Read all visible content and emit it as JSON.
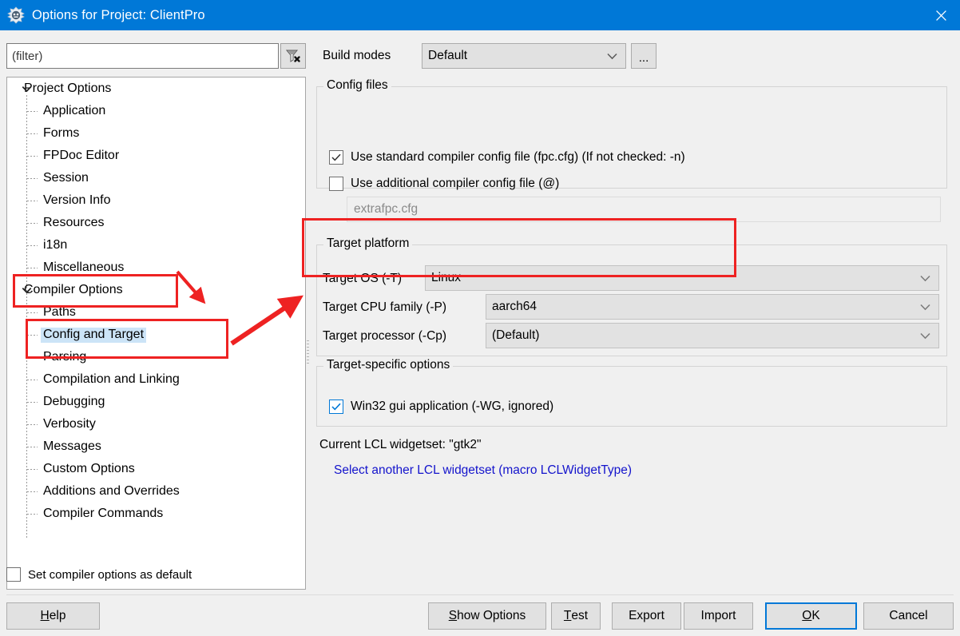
{
  "window": {
    "title": "Options for Project: ClientPro",
    "icon": "lazarus-logo-icon",
    "close_label": "✕"
  },
  "filter": {
    "placeholder": "(filter)",
    "value": "",
    "clear_icon": "filter-clear-icon"
  },
  "build_modes": {
    "label": "Build modes",
    "value": "Default",
    "ellipsis_label": "...",
    "dropdown_icon": "chevron-down-icon"
  },
  "tree": {
    "items": [
      {
        "label": "Project Options",
        "level": 0,
        "expander": "chevron-down",
        "selected": false
      },
      {
        "label": "Application",
        "level": 1,
        "expander": "",
        "selected": false
      },
      {
        "label": "Forms",
        "level": 1,
        "expander": "",
        "selected": false
      },
      {
        "label": "FPDoc Editor",
        "level": 1,
        "expander": "",
        "selected": false
      },
      {
        "label": "Session",
        "level": 1,
        "expander": "",
        "selected": false
      },
      {
        "label": "Version Info",
        "level": 1,
        "expander": "",
        "selected": false
      },
      {
        "label": "Resources",
        "level": 1,
        "expander": "",
        "selected": false
      },
      {
        "label": "i18n",
        "level": 1,
        "expander": "",
        "selected": false
      },
      {
        "label": "Miscellaneous",
        "level": 1,
        "expander": "",
        "selected": false
      },
      {
        "label": "Compiler Options",
        "level": 0,
        "expander": "chevron-down",
        "selected": false
      },
      {
        "label": "Paths",
        "level": 1,
        "expander": "",
        "selected": false
      },
      {
        "label": "Config and Target",
        "level": 1,
        "expander": "",
        "selected": true
      },
      {
        "label": "Parsing",
        "level": 1,
        "expander": "",
        "selected": false
      },
      {
        "label": "Compilation and Linking",
        "level": 1,
        "expander": "",
        "selected": false
      },
      {
        "label": "Debugging",
        "level": 1,
        "expander": "",
        "selected": false
      },
      {
        "label": "Verbosity",
        "level": 1,
        "expander": "",
        "selected": false
      },
      {
        "label": "Messages",
        "level": 1,
        "expander": "",
        "selected": false
      },
      {
        "label": "Custom Options",
        "level": 1,
        "expander": "",
        "selected": false
      },
      {
        "label": "Additions and Overrides",
        "level": 1,
        "expander": "",
        "selected": false
      },
      {
        "label": "Compiler Commands",
        "level": 1,
        "expander": "",
        "selected": false
      }
    ]
  },
  "config_files": {
    "caption": "Config files",
    "standard_cfg_label": "Use standard compiler config file (fpc.cfg) (If not checked: -n)",
    "standard_cfg_checked": true,
    "additional_cfg_label": "Use additional compiler config file (@)",
    "additional_cfg_checked": false,
    "additional_cfg_value": "extrafpc.cfg"
  },
  "target_platform": {
    "caption": "Target platform",
    "rows": [
      {
        "label": "Target OS (-T)",
        "value": "Linux"
      },
      {
        "label": "Target CPU family (-P)",
        "value": "aarch64"
      },
      {
        "label": "Target processor (-Cp)",
        "value": "(Default)"
      }
    ]
  },
  "target_specific": {
    "caption": "Target-specific options",
    "win32_gui_label": "Win32 gui application (-WG, ignored)",
    "win32_gui_checked": true
  },
  "widgetset": {
    "current_line": "Current LCL widgetset: \"gtk2\"",
    "link_label": "Select another LCL widgetset (macro LCLWidgetType)"
  },
  "footer": {
    "set_default_label": "Set compiler options as default",
    "set_default_checked": false,
    "buttons": [
      {
        "name": "help",
        "pre": "",
        "mnemonic": "H",
        "post": "elp"
      },
      {
        "name": "show-options",
        "pre": "",
        "mnemonic": "S",
        "post": "how Options"
      },
      {
        "name": "test",
        "pre": "",
        "mnemonic": "T",
        "post": "est"
      },
      {
        "name": "export",
        "pre": "Export",
        "mnemonic": "",
        "post": ""
      },
      {
        "name": "import",
        "pre": "Import",
        "mnemonic": "",
        "post": ""
      },
      {
        "name": "ok",
        "pre": "",
        "mnemonic": "O",
        "post": "K"
      },
      {
        "name": "cancel",
        "pre": "Cancel",
        "mnemonic": "",
        "post": ""
      }
    ]
  },
  "annotations": {
    "color": "#ee2222",
    "boxes": [
      {
        "name": "compiler-options-highlight"
      },
      {
        "name": "config-and-target-highlight"
      },
      {
        "name": "target-platform-highlight"
      }
    ],
    "arrows": [
      {
        "name": "arrow-to-config-and-target"
      },
      {
        "name": "arrow-to-target-platform"
      }
    ]
  }
}
